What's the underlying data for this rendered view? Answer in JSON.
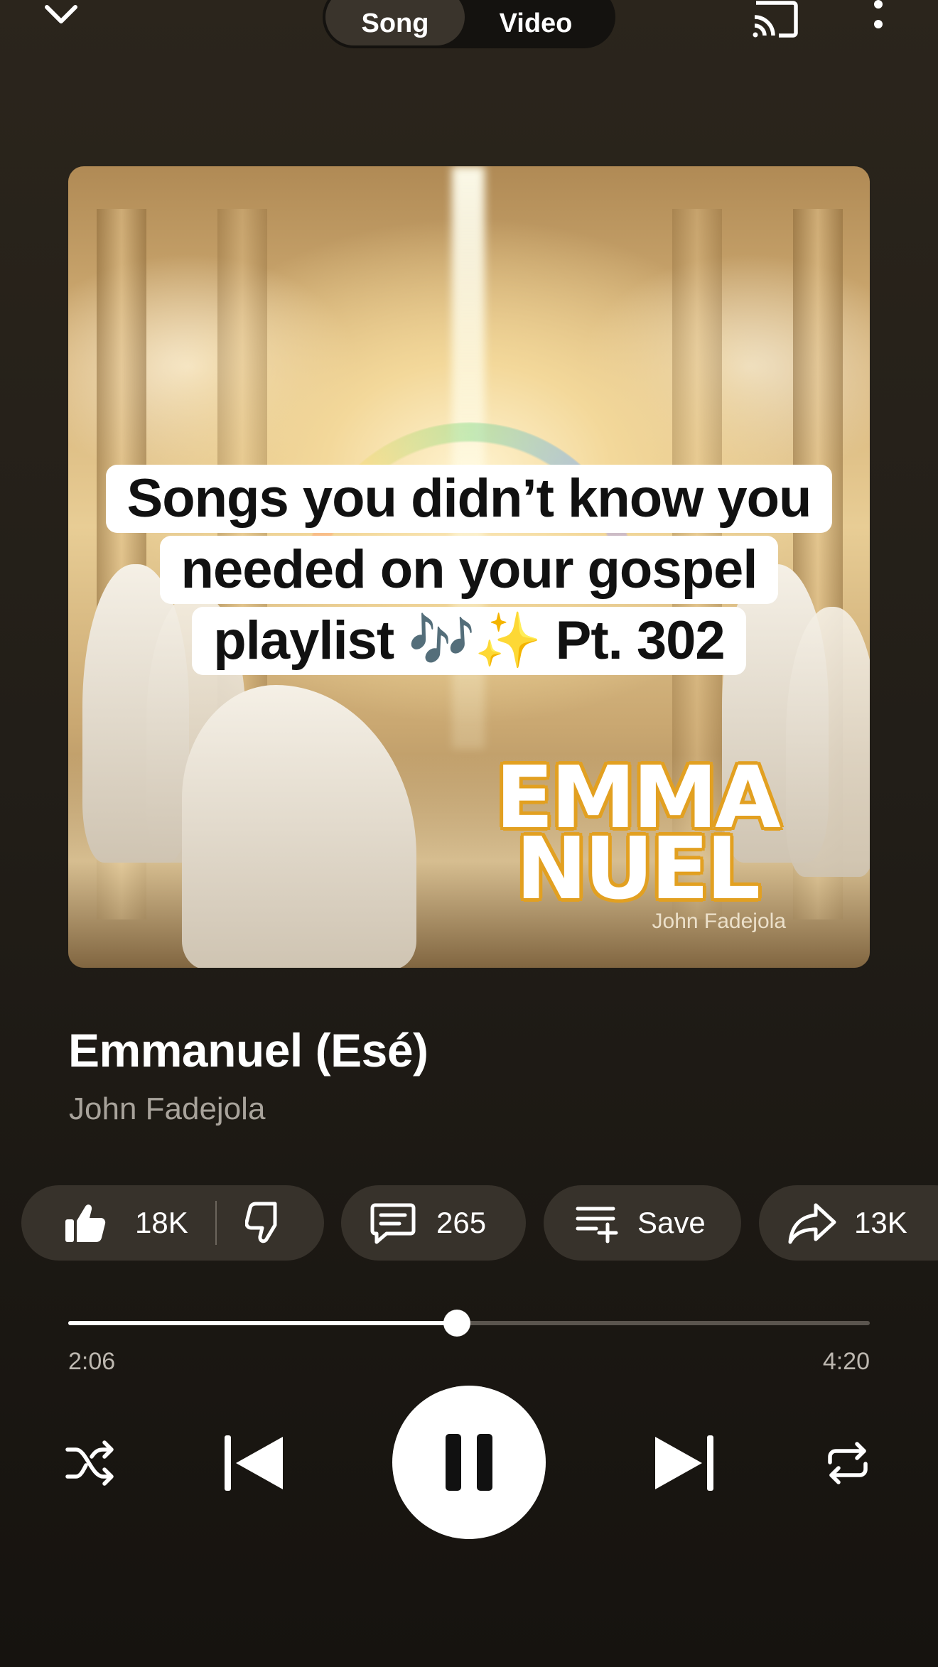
{
  "header": {
    "collapse_icon": "chevron-down-icon",
    "tabs": [
      {
        "label": "Song",
        "active": true
      },
      {
        "label": "Video",
        "active": false
      }
    ],
    "cast_icon": "cast-icon",
    "more_icon": "more-vertical-icon"
  },
  "artwork": {
    "caption_lines": [
      "Songs you didn’t know you",
      "needed on your gospel",
      "playlist 🎶✨ Pt. 302"
    ],
    "logo_lines": [
      "EMMA",
      "NUEL"
    ],
    "logo_artist": "John Fadejola",
    "logo_color": "#e2a021"
  },
  "track": {
    "title": "Emmanuel (Esé)",
    "artist": "John Fadejola"
  },
  "actions": {
    "likes": "18K",
    "comments": "265",
    "save_label": "Save",
    "shares": "13K"
  },
  "progress": {
    "elapsed": "2:06",
    "total": "4:20",
    "fraction": 0.4846
  },
  "controls": {
    "shuffle_icon": "shuffle-icon",
    "previous_icon": "skip-previous-icon",
    "play_state": "playing",
    "pause_icon": "pause-icon",
    "next_icon": "skip-next-icon",
    "repeat_icon": "repeat-icon"
  }
}
